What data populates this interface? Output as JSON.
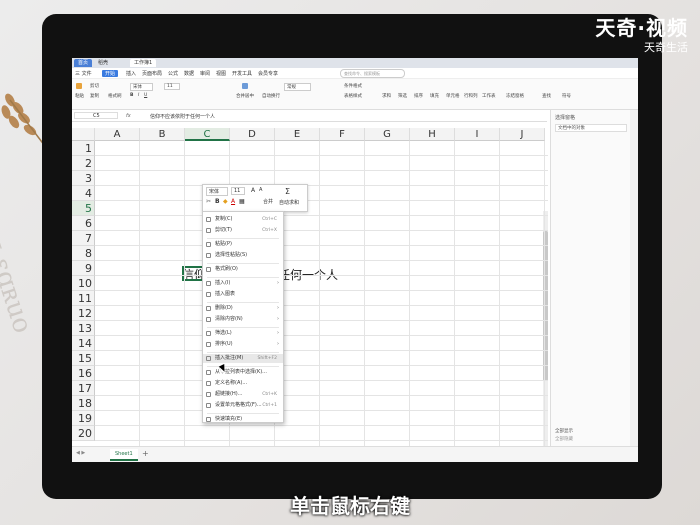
{
  "watermark": {
    "title": "天奇·视频",
    "subtitle": "天奇生活"
  },
  "caption": "单击鼠标右键",
  "tabs": [
    {
      "label": "首页"
    },
    {
      "label": "稻壳"
    },
    {
      "label": "工作簿1"
    }
  ],
  "menus": [
    "三 文件",
    "开始",
    "插入",
    "页面布局",
    "公式",
    "数据",
    "审阅",
    "视图",
    "开发工具",
    "会员专享"
  ],
  "search_placeholder": "查找命令、搜索模板",
  "ribbon": {
    "paste": "粘贴",
    "cut": "剪切",
    "copy": "复制",
    "format_painter": "格式刷",
    "font": "宋体",
    "size": "11",
    "merge": "合并居中",
    "wrap": "自动换行",
    "number_format": "常规",
    "cond_format": "条件格式",
    "table_style": "表格样式",
    "sum": "求和",
    "filter": "筛选",
    "sort": "排序",
    "fill": "填充",
    "cell": "单元格",
    "row_col": "行和列",
    "sheet": "工作表",
    "freeze": "冻结窗格",
    "find": "查找",
    "symbol": "符号"
  },
  "formula_bar": {
    "name_box": "C5",
    "content": "信仰不应该依附于任何一个人"
  },
  "columns": [
    "A",
    "B",
    "C",
    "D",
    "E",
    "F",
    "G",
    "H",
    "I",
    "J"
  ],
  "rows": [
    "1",
    "2",
    "3",
    "4",
    "5",
    "6",
    "7",
    "8",
    "9",
    "10",
    "11",
    "12",
    "13",
    "14",
    "15",
    "16",
    "17",
    "18",
    "19",
    "20"
  ],
  "cell_c5": "信仰不应该依附于任何一个人",
  "mini_toolbar": {
    "font": "宋体",
    "size": "11",
    "merge": "合并",
    "autosum": "自动求和"
  },
  "context_menu": [
    {
      "label": "复制(C)",
      "shortcut": "Ctrl+C"
    },
    {
      "label": "剪切(T)",
      "shortcut": "Ctrl+X"
    },
    {
      "label": "粘贴(P)",
      "shortcut": ""
    },
    {
      "label": "选择性粘贴(S)",
      "shortcut": ""
    },
    {
      "label": "格式刷(O)",
      "shortcut": ""
    },
    {
      "label": "插入(I)",
      "shortcut": ""
    },
    {
      "label": "插入图表",
      "shortcut": ""
    },
    {
      "label": "删除(D)",
      "shortcut": ""
    },
    {
      "label": "清除内容(N)",
      "shortcut": ""
    },
    {
      "label": "筛选(L)",
      "shortcut": ""
    },
    {
      "label": "排序(U)",
      "shortcut": ""
    },
    {
      "label": "插入批注(M)",
      "shortcut": "Shift+F2"
    },
    {
      "label": "从下拉列表中选择(K)...",
      "shortcut": ""
    },
    {
      "label": "定义名称(A)...",
      "shortcut": ""
    },
    {
      "label": "超链接(H)...",
      "shortcut": "Ctrl+K"
    },
    {
      "label": "设置单元格格式(F)...",
      "shortcut": "Ctrl+1"
    },
    {
      "label": "快速填充(E)",
      "shortcut": ""
    }
  ],
  "sheet_tab": "Sheet1",
  "right_pane": {
    "title": "选择窗格",
    "box": "文档中的对象",
    "foot": "全部显示",
    "foot2": "全部隐藏"
  },
  "colors": {
    "accent": "#217346",
    "tab_blue": "#4a7fd6",
    "bezel": "#111111"
  }
}
